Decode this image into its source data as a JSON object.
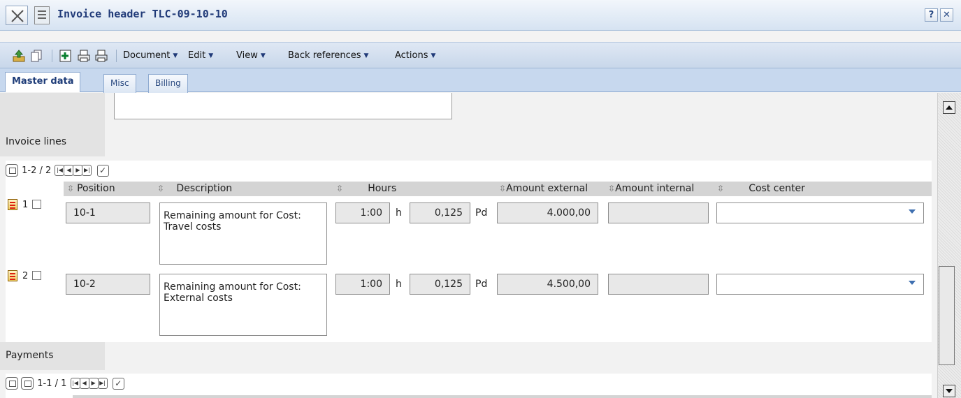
{
  "window": {
    "title": "Invoice header TLC-09-10-10",
    "help_label": "?",
    "close_label": "✕"
  },
  "toolbar": {
    "icons": [
      "export-icon",
      "copy-icon",
      "new-document-icon",
      "print-icon",
      "print-preview-icon"
    ],
    "menus": [
      {
        "label": "Document"
      },
      {
        "label": "Edit"
      },
      {
        "label": "View"
      },
      {
        "label": "Back references"
      },
      {
        "label": "Actions"
      }
    ]
  },
  "tabs": [
    {
      "label": "Master data",
      "active": true
    },
    {
      "label": "Misc",
      "active": false
    },
    {
      "label": "Billing",
      "active": false
    }
  ],
  "invoice_lines": {
    "title": "Invoice lines",
    "pager_text": "1-2 / 2",
    "columns": {
      "position": "Position",
      "description": "Description",
      "hours": "Hours",
      "amount_external": "Amount external",
      "amount_internal": "Amount internal",
      "cost_center": "Cost center"
    },
    "rows": [
      {
        "num": "1",
        "position": "10-1",
        "description": "Remaining amount for Cost: Travel costs",
        "hours": "1:00",
        "hours_unit": "h",
        "days": "0,125",
        "days_unit": "Pd",
        "amount_external": "4.000,00",
        "amount_internal": "",
        "cost_center": ""
      },
      {
        "num": "2",
        "position": "10-2",
        "description": "Remaining amount for Cost: External costs",
        "hours": "1:00",
        "hours_unit": "h",
        "days": "0,125",
        "days_unit": "Pd",
        "amount_external": "4.500,00",
        "amount_internal": "",
        "cost_center": ""
      }
    ]
  },
  "payments": {
    "title": "Payments",
    "pager_text": "1-1 / 1"
  }
}
